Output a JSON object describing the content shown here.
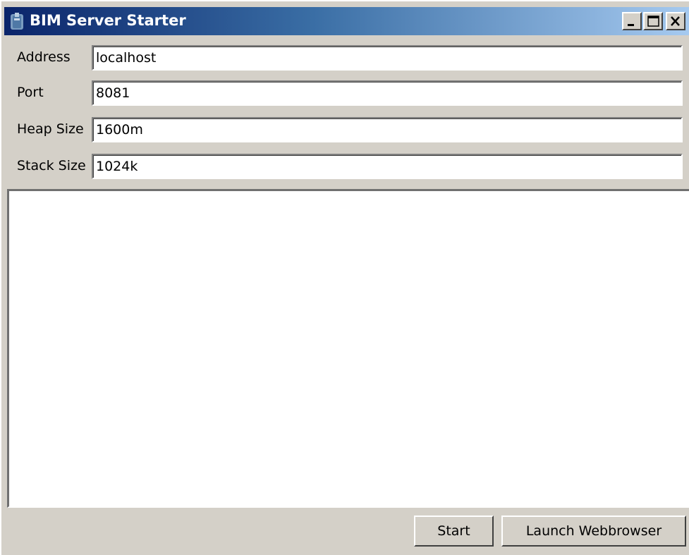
{
  "window": {
    "title": "BIM Server Starter",
    "icon": "bim-server-icon",
    "controls": [
      "minimize-icon",
      "maximize-icon",
      "close-icon"
    ]
  },
  "form": {
    "address": {
      "label": "Address",
      "value": "localhost"
    },
    "port": {
      "label": "Port",
      "value": "8081"
    },
    "heap_size": {
      "label": "Heap Size",
      "value": "1600m"
    },
    "stack_size": {
      "label": "Stack Size",
      "value": "1024k"
    }
  },
  "log": {
    "content": ""
  },
  "buttons": {
    "start": "Start",
    "launch": "Launch Webbrowser"
  },
  "colors": {
    "titlebar_start": "#0a246a",
    "titlebar_end": "#a6caf0",
    "window_bg": "#d4d0c8"
  }
}
